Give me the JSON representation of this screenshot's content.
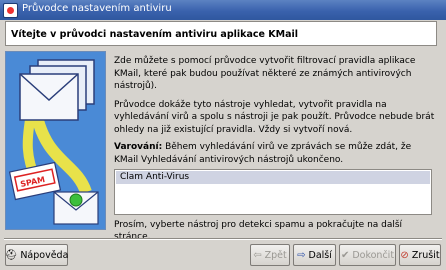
{
  "window": {
    "title": "Průvodce nastavením antiviru"
  },
  "header": {
    "title": "Vítejte v průvodci nastavením antiviru aplikace KMail"
  },
  "body": {
    "paragraph1": "Zde můžete s pomocí průvodce vytvořit filtrovací pravidla aplikace KMail, které pak budou používat některé ze známých antivirových nástrojů).",
    "paragraph2": "Průvodce dokáže tyto nástroje vyhledat, vytvořit pravidla na vyhledávání virů a spolu s nástroji je pak použít. Průvodce nebude brát ohledy na již existující pravidla. Vždy si vytvoří nová.",
    "warning_label": "Varování:",
    "warning_text": "Během vyhledávání virů ve zprávách se může zdát, že KMail Vyhledávání antivirových nástrojů ukončeno.",
    "tools": [
      "Clam Anti-Virus"
    ],
    "hint": "Prosím, vyberte nástroj pro detekci spamu a pokračujte na další stránce."
  },
  "art": {
    "spam_label": "SPAM"
  },
  "buttons": {
    "help": "Nápověda",
    "back": "Zpět",
    "next": "Další",
    "finish": "Dokončit",
    "cancel": "Zrušit"
  },
  "icons": {
    "help": "lifebuoy-icon",
    "back": "arrow-left-icon",
    "next": "arrow-right-icon",
    "finish": "checkmark-icon",
    "cancel": "cancel-icon"
  },
  "colors": {
    "titlebar": "#3a62ad",
    "art_background": "#4a8ad6",
    "selection": "#cfd3e2"
  }
}
